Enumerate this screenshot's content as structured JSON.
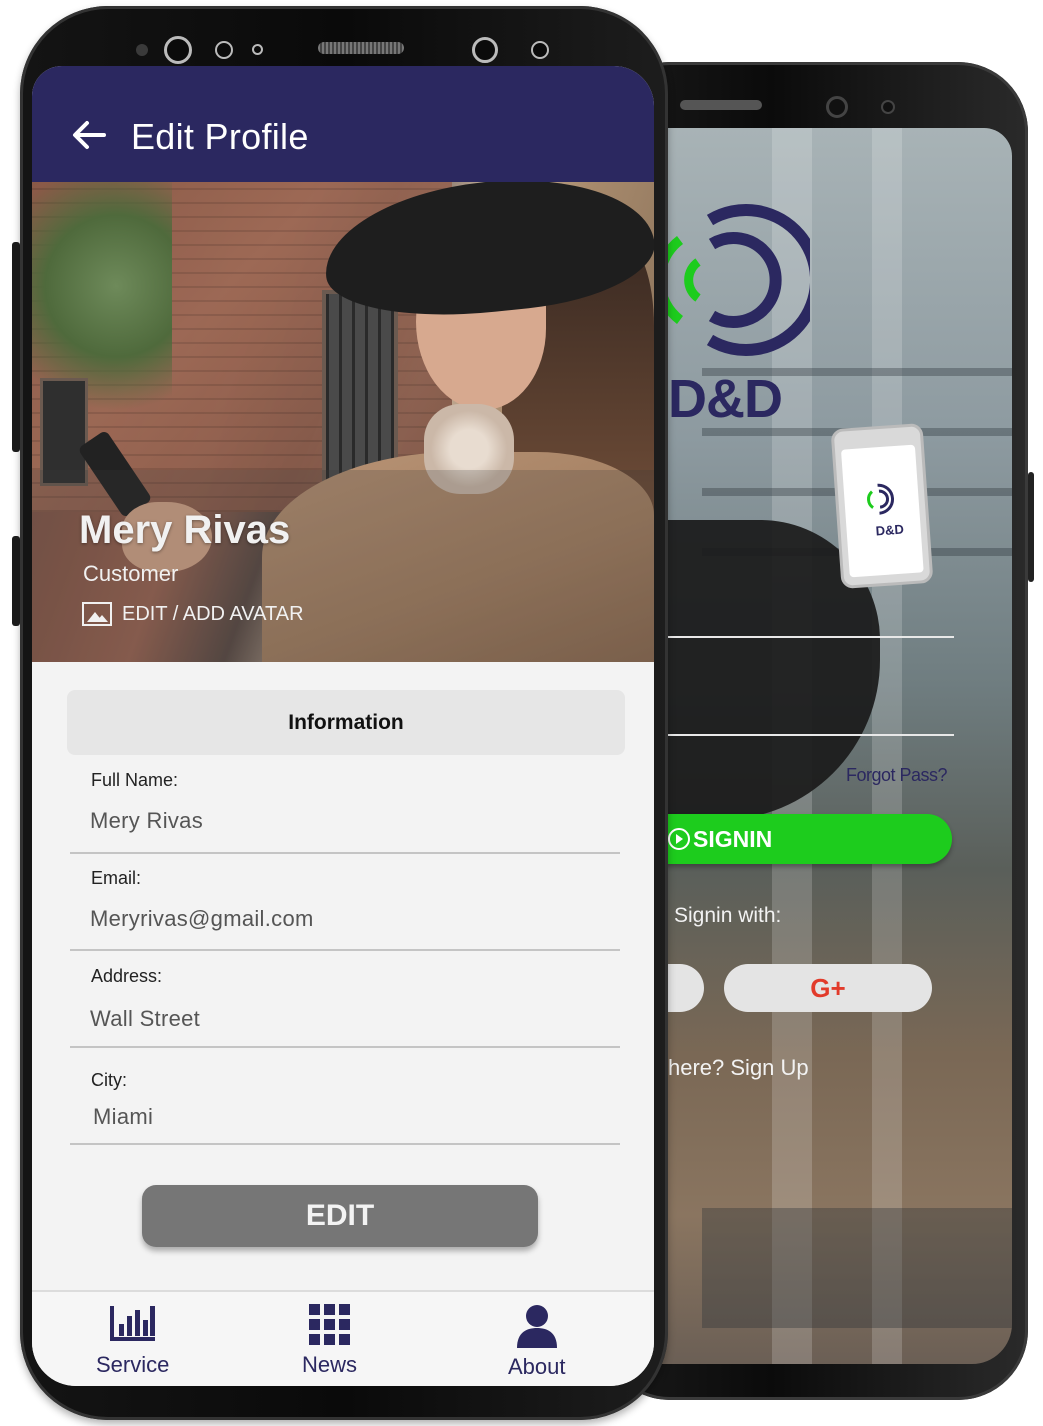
{
  "front": {
    "appbar": {
      "title": "Edit Profile"
    },
    "profile": {
      "name": "Mery Rivas",
      "role": "Customer",
      "avatar_action": "EDIT / ADD AVATAR"
    },
    "info_section": {
      "title": "Information"
    },
    "fields": [
      {
        "label": "Full Name:",
        "value": "Mery Rivas"
      },
      {
        "label": "Email:",
        "value": "Meryrivas@gmail.com"
      },
      {
        "label": "Address:",
        "value": "Wall Street"
      },
      {
        "label": "City:",
        "value": "Miami"
      }
    ],
    "edit_button": "EDIT",
    "nav": [
      {
        "label": "Service",
        "icon": "bar-chart-icon"
      },
      {
        "label": "News",
        "icon": "grid-icon"
      },
      {
        "label": "About",
        "icon": "user-icon"
      }
    ]
  },
  "back": {
    "brand": "D&D",
    "small_brand": "D&D",
    "forgot": "Forgot Pass?",
    "signin": "SIGNIN",
    "signin_with": "Signin with:",
    "google": "G+",
    "signup": "here? Sign Up"
  },
  "colors": {
    "primary": "#2b2860",
    "accent_green": "#1dcc1d",
    "edit_button": "#767676",
    "google": "#e23b2b"
  }
}
